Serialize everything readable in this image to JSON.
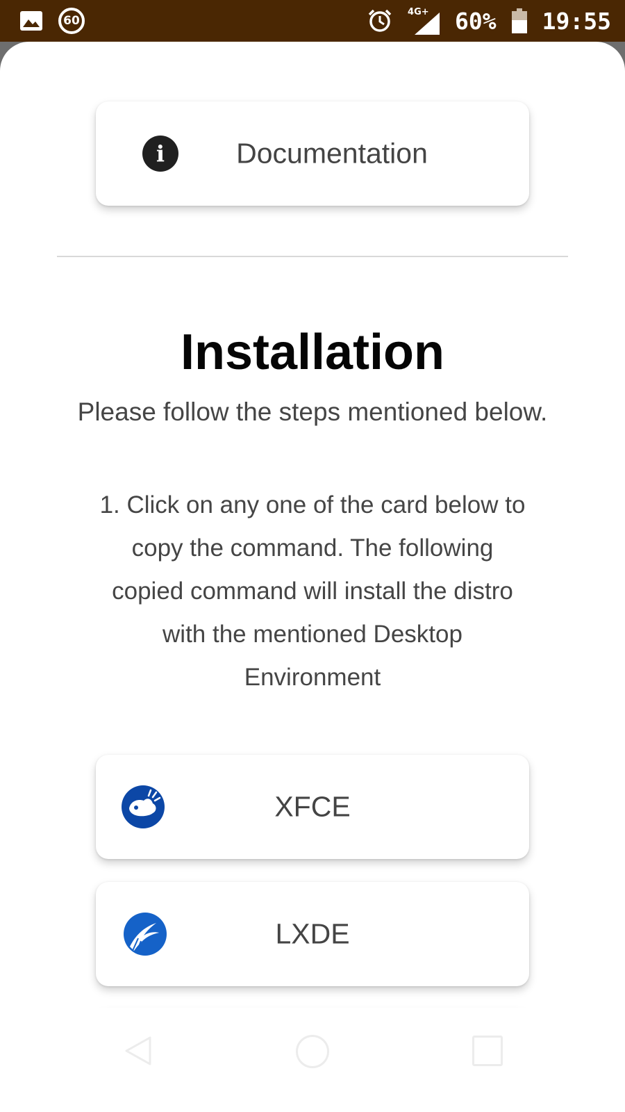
{
  "status_bar": {
    "network": "4G+",
    "battery": "60%",
    "battery_level": 0.6,
    "time": "19:55",
    "notification_badge": "60",
    "icons": [
      "gallery-icon",
      "sixty-badge-icon",
      "alarm-icon",
      "signal-icon",
      "battery-icon"
    ]
  },
  "documentation_card": {
    "label": "Documentation",
    "icon": "info-icon"
  },
  "installation": {
    "title": "Installation",
    "subtitle": "Please follow the steps mentioned below.",
    "step_1": "1. Click on any one of the card below to copy the command. The following copied command will install the distro with the mentioned Desktop Environment"
  },
  "distro_cards": [
    {
      "label": "XFCE",
      "icon": "xfce-icon",
      "color": "#0c47a6"
    },
    {
      "label": "LXDE",
      "icon": "lxde-icon",
      "color": "#1562c8"
    }
  ],
  "nav_bar": {
    "icons": [
      "back-icon",
      "home-icon",
      "recent-apps-icon"
    ]
  },
  "colors": {
    "status_bar": "#4a2703",
    "title": "#050505",
    "body_text": "#454545"
  }
}
